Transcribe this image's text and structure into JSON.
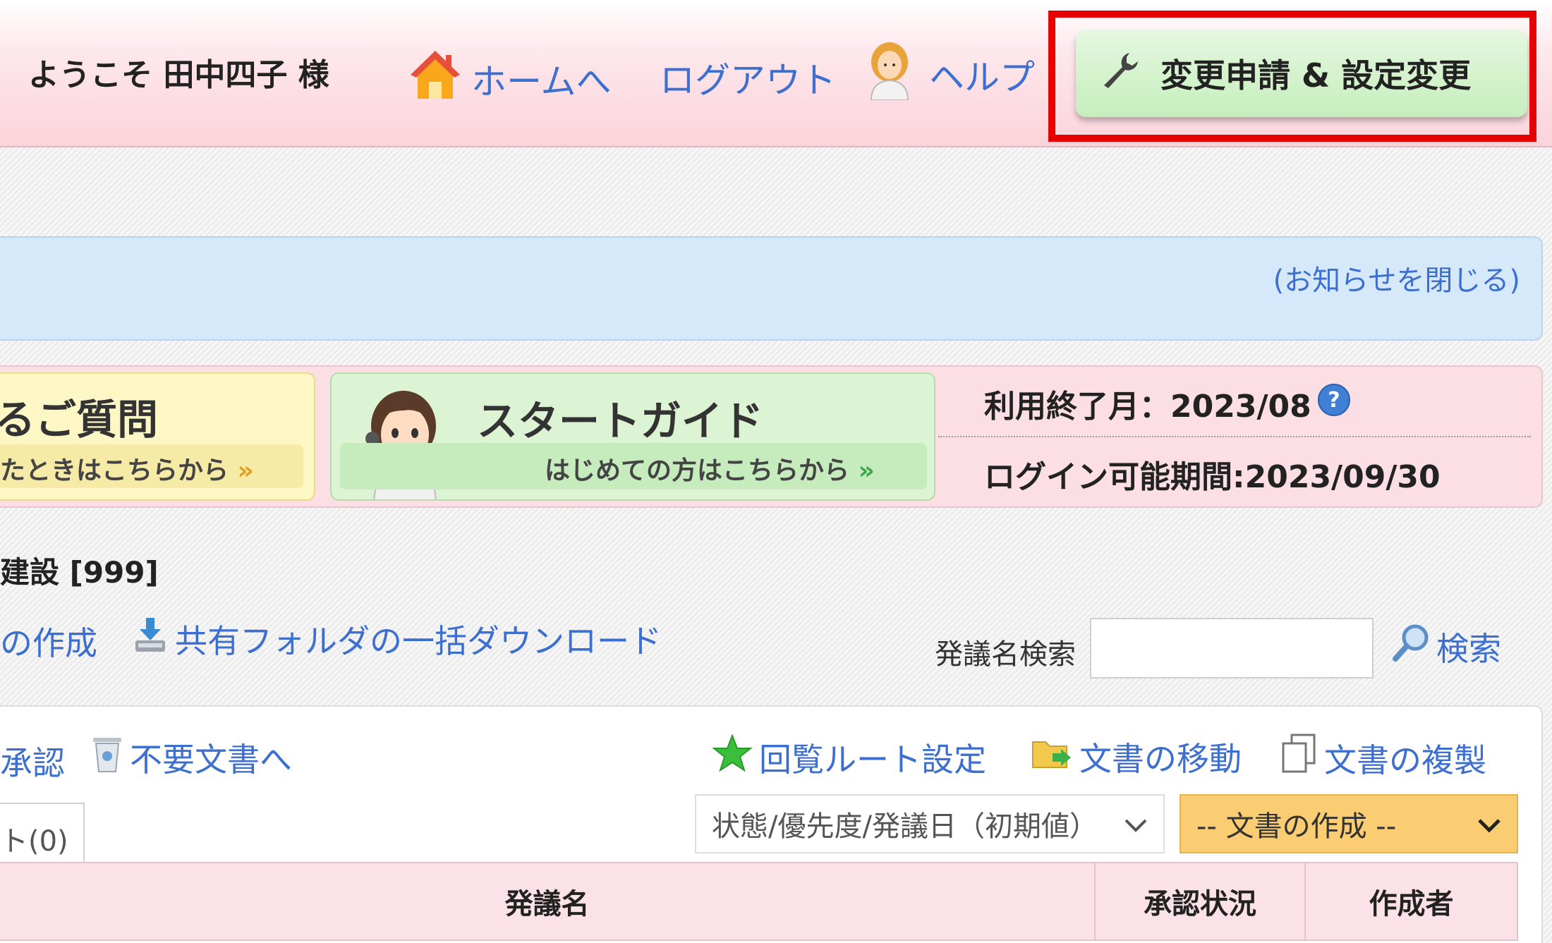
{
  "header": {
    "welcome": "ようこそ 田中四子 様",
    "home_link": "ホームへ",
    "logout_link": "ログアウト",
    "help_link": "ヘルプ",
    "settings_button": "変更申請 & 設定変更"
  },
  "notice": {
    "close_link": "(お知らせを閉じる)"
  },
  "banners": {
    "faq_title": "るご質問",
    "faq_sub": "たときはこちらから",
    "guide_title": "スタートガイド",
    "guide_sub": "はじめての方はこちらから",
    "chevron": "»"
  },
  "account": {
    "end_month": "利用終了月：2023/08",
    "login_period": "ログイン可能期間:2023/09/30"
  },
  "org": {
    "name": "建設 [999]"
  },
  "toolbar": {
    "create_link": "の作成",
    "download_link": "共有フォルダの一括ダウンロード",
    "search_label": "発議名検索",
    "search_value": "",
    "search_button": "検索"
  },
  "doc_toolbar": {
    "approve_link": "承認",
    "trash_link": "不要文書へ",
    "route_link": "回覧ルート設定",
    "move_link": "文書の移動",
    "copy_link": "文書の複製",
    "list_tab": "ト(0)",
    "sort_select": "状態/優先度/発議日（初期値）",
    "create_select": "-- 文書の作成 --"
  },
  "table": {
    "headers": [
      "発議名",
      "承認状況",
      "作成者"
    ]
  },
  "colors": {
    "link": "#3c6fcf",
    "header_pink": "#fbd3db",
    "settings_green": "#c6eebc",
    "highlight_red": "#e60000",
    "create_orange": "#fbcd73"
  }
}
